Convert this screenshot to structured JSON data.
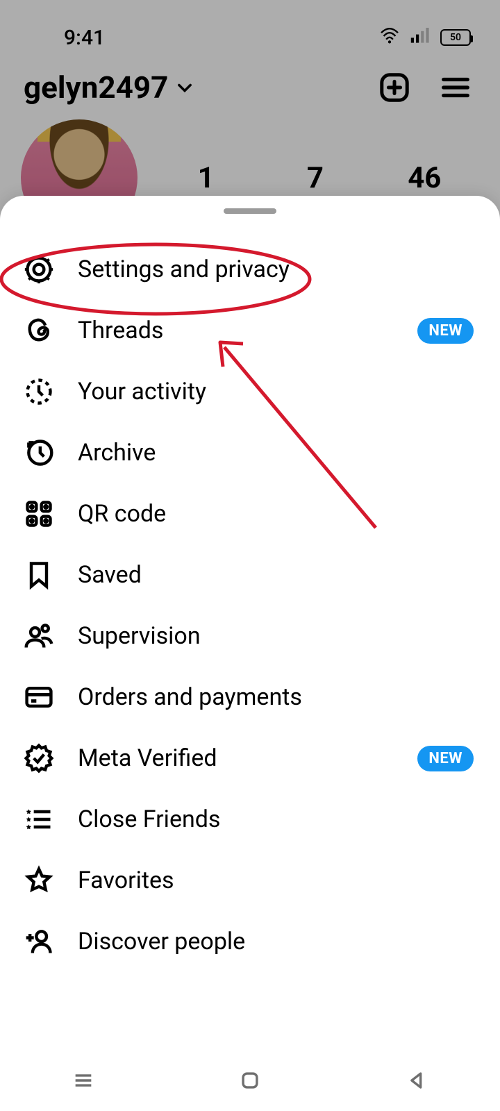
{
  "status": {
    "time": "9:41",
    "battery": "50"
  },
  "profile": {
    "username": "gelyn2497",
    "stats": {
      "posts": "1",
      "followers": "7",
      "following": "46"
    }
  },
  "sheet": {
    "new_badge": "NEW",
    "items": [
      {
        "key": "settings",
        "label": "Settings and privacy",
        "new": false
      },
      {
        "key": "threads",
        "label": "Threads",
        "new": true
      },
      {
        "key": "activity",
        "label": "Your activity",
        "new": false
      },
      {
        "key": "archive",
        "label": "Archive",
        "new": false
      },
      {
        "key": "qr",
        "label": "QR code",
        "new": false
      },
      {
        "key": "saved",
        "label": "Saved",
        "new": false
      },
      {
        "key": "supervision",
        "label": "Supervision",
        "new": false
      },
      {
        "key": "orders",
        "label": "Orders and payments",
        "new": false
      },
      {
        "key": "verified",
        "label": "Meta Verified",
        "new": true
      },
      {
        "key": "close",
        "label": "Close Friends",
        "new": false
      },
      {
        "key": "favorites",
        "label": "Favorites",
        "new": false
      },
      {
        "key": "discover",
        "label": "Discover people",
        "new": false
      }
    ]
  },
  "annotation": {
    "highlight_item": "settings",
    "color": "#d4192d"
  }
}
